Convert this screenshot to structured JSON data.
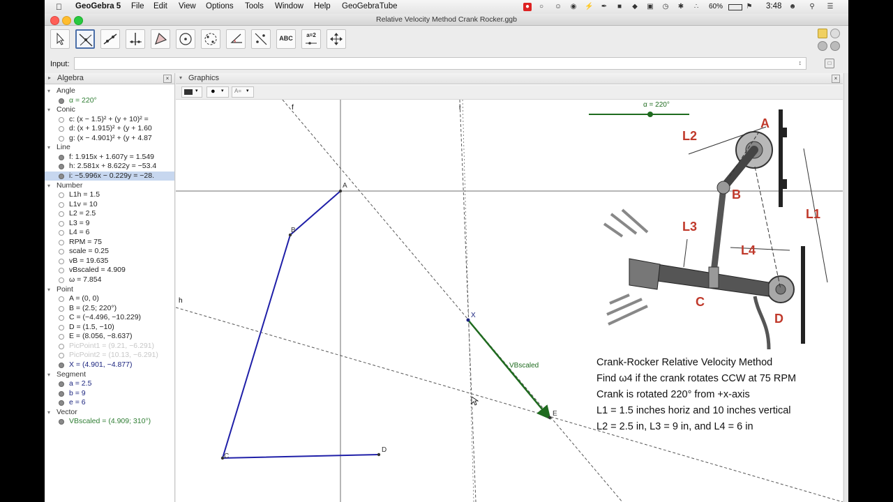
{
  "menubar": {
    "app_name": "GeoGebra 5",
    "items": [
      "File",
      "Edit",
      "View",
      "Options",
      "Tools",
      "Window",
      "Help",
      "GeoGebraTube"
    ],
    "battery": "60%",
    "time": "3:48"
  },
  "window": {
    "title": "Relative Velocity Method Crank Rocker.ggb"
  },
  "toolbar": {
    "tools": [
      {
        "icon": "move-arrow-icon"
      },
      {
        "icon": "perpendicular-line-icon",
        "selected": true
      },
      {
        "icon": "line-through-points-icon"
      },
      {
        "icon": "perpendicular-bisector-icon"
      },
      {
        "icon": "polygon-icon"
      },
      {
        "icon": "circle-with-center-icon"
      },
      {
        "icon": "ellipse-icon"
      },
      {
        "icon": "angle-icon"
      },
      {
        "icon": "reflect-about-line-icon"
      },
      {
        "icon": "text-tool-icon",
        "label": "ABC"
      },
      {
        "icon": "slider-tool-icon",
        "label": "a=2"
      },
      {
        "icon": "move-graphics-view-icon"
      }
    ]
  },
  "input": {
    "label": "Input:",
    "value": ""
  },
  "algebra": {
    "title": "Algebra",
    "rows": [
      {
        "type": "cat",
        "text": "Angle"
      },
      {
        "type": "item",
        "text": "α = 220°",
        "color": "#2e7d32",
        "checked": true
      },
      {
        "type": "cat",
        "text": "Conic"
      },
      {
        "type": "item",
        "text": "c: (x − 1.5)² + (y + 10)² =",
        "color": "#222",
        "checked": false
      },
      {
        "type": "item",
        "text": "d: (x + 1.915)² + (y + 1.60",
        "color": "#222",
        "checked": false
      },
      {
        "type": "item",
        "text": "g: (x − 4.901)² + (y + 4.87",
        "color": "#222",
        "checked": false
      },
      {
        "type": "cat",
        "text": "Line"
      },
      {
        "type": "item",
        "text": "f: 1.915x + 1.607y = 1.549",
        "color": "#222",
        "checked": true
      },
      {
        "type": "item",
        "text": "h: 2.581x + 8.622y = −53.4",
        "color": "#222",
        "checked": true
      },
      {
        "type": "item",
        "text": "i: −5.996x − 0.229y = −28.",
        "color": "#222",
        "checked": true,
        "highlight": true
      },
      {
        "type": "cat",
        "text": "Number"
      },
      {
        "type": "item",
        "text": "L1h = 1.5",
        "color": "#222",
        "checked": false
      },
      {
        "type": "item",
        "text": "L1v = 10",
        "color": "#222",
        "checked": false
      },
      {
        "type": "item",
        "text": "L2 = 2.5",
        "color": "#222",
        "checked": false
      },
      {
        "type": "item",
        "text": "L3 = 9",
        "color": "#222",
        "checked": false
      },
      {
        "type": "item",
        "text": "L4 = 6",
        "color": "#222",
        "checked": false
      },
      {
        "type": "item",
        "text": "RPM = 75",
        "color": "#222",
        "checked": false
      },
      {
        "type": "item",
        "text": "scale = 0.25",
        "color": "#222",
        "checked": false
      },
      {
        "type": "item",
        "text": "vB = 19.635",
        "color": "#222",
        "checked": false
      },
      {
        "type": "item",
        "text": "vBscaled = 4.909",
        "color": "#222",
        "checked": false
      },
      {
        "type": "item",
        "text": "ω = 7.854",
        "color": "#222",
        "checked": false
      },
      {
        "type": "cat",
        "text": "Point"
      },
      {
        "type": "item",
        "text": "A = (0, 0)",
        "color": "#222",
        "checked": false
      },
      {
        "type": "item",
        "text": "B = (2.5; 220°)",
        "color": "#222",
        "checked": false
      },
      {
        "type": "item",
        "text": "C = (−4.496, −10.229)",
        "color": "#222",
        "checked": false
      },
      {
        "type": "item",
        "text": "D = (1.5, −10)",
        "color": "#222",
        "checked": false
      },
      {
        "type": "item",
        "text": "E = (8.056, −8.637)",
        "color": "#222",
        "checked": false
      },
      {
        "type": "item",
        "text": "PicPoint1 = (9.21, −6.291)",
        "color": "#c8c8c8",
        "checked": false
      },
      {
        "type": "item",
        "text": "PicPoint2 = (10.13, −6.291)",
        "color": "#c8c8c8",
        "checked": false
      },
      {
        "type": "item",
        "text": "X = (4.901, −4.877)",
        "color": "#1a237e",
        "checked": true
      },
      {
        "type": "cat",
        "text": "Segment"
      },
      {
        "type": "item",
        "text": "a = 2.5",
        "color": "#1a237e",
        "checked": true
      },
      {
        "type": "item",
        "text": "b = 9",
        "color": "#1a237e",
        "checked": true
      },
      {
        "type": "item",
        "text": "e = 6",
        "color": "#1a237e",
        "checked": true
      },
      {
        "type": "cat",
        "text": "Vector"
      },
      {
        "type": "item",
        "text": "VBscaled = (4.909; 310°)",
        "color": "#2e7d32",
        "checked": true
      }
    ]
  },
  "graphics": {
    "title": "Graphics",
    "slider_label": "α = 220°",
    "slider_fraction": 0.611,
    "line_labels": {
      "f": "f",
      "i": "i",
      "h": "h"
    },
    "point_labels": {
      "A": "A",
      "B": "B",
      "C": "C",
      "D": "D",
      "X": "X",
      "E": "E"
    },
    "vector_label": "VBscaled",
    "colors": {
      "linkage": "#1f1fa8",
      "vector": "#1f6b1f",
      "axis": "#6e6e6e"
    },
    "figure_labels": {
      "A": "A",
      "B": "B",
      "C": "C",
      "D": "D",
      "L1": "L1",
      "L2": "L2",
      "L3": "L3",
      "L4": "L4"
    },
    "description": [
      "Crank-Rocker Relative Velocity Method",
      "Find ω4 if the crank rotates CCW at 75 RPM",
      "Crank is rotated 220° from +x-axis",
      "L1 = 1.5 inches horiz and 10 inches vertical",
      "L2 = 2.5 in, L3 = 9 in, and L4 = 6 in"
    ]
  }
}
